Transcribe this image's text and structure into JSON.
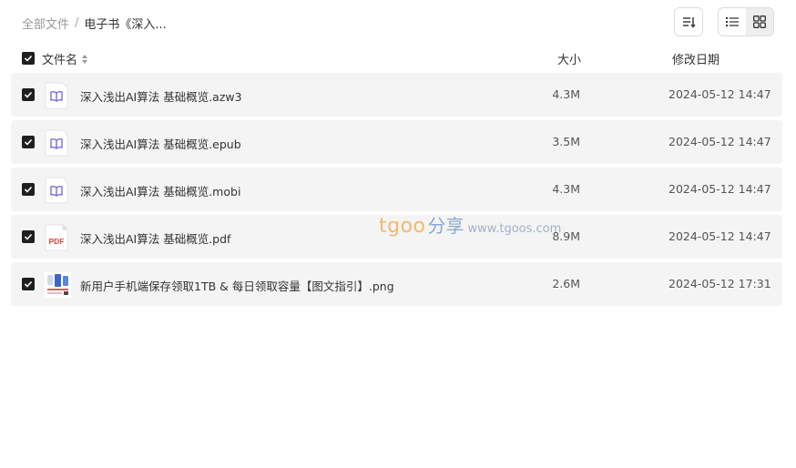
{
  "breadcrumb": {
    "root": "全部文件",
    "separator": "/",
    "current": "电子书《深入..."
  },
  "toolbar": {
    "sort_icon": "sort-icon",
    "list_view_icon": "list-view-icon",
    "grid_view_icon": "grid-view-icon"
  },
  "table": {
    "headers": {
      "name": "文件名",
      "size": "大小",
      "date": "修改日期"
    },
    "rows": [
      {
        "name": "深入浅出AI算法 基础概览.azw3",
        "size": "4.3M",
        "date": "2024-05-12 14:47",
        "icon": "ebook-icon"
      },
      {
        "name": "深入浅出AI算法 基础概览.epub",
        "size": "3.5M",
        "date": "2024-05-12 14:47",
        "icon": "ebook-icon"
      },
      {
        "name": "深入浅出AI算法 基础概览.mobi",
        "size": "4.3M",
        "date": "2024-05-12 14:47",
        "icon": "ebook-icon"
      },
      {
        "name": "深入浅出AI算法 基础概览.pdf",
        "size": "8.9M",
        "date": "2024-05-12 14:47",
        "icon": "pdf-icon"
      },
      {
        "name": "新用户手机端保存领取1TB & 每日领取容量【图文指引】.png",
        "size": "2.6M",
        "date": "2024-05-12 17:31",
        "icon": "image-thumbnail"
      }
    ]
  },
  "watermark": {
    "brand": "tgoo",
    "share": "分享",
    "url": "www.tgoos.com"
  },
  "colors": {
    "row_bg": "#f4f4f5",
    "checkbox": "#1f1f1f",
    "ebook_icon": "#7b6cd9",
    "pdf_icon": "#e0453a"
  }
}
